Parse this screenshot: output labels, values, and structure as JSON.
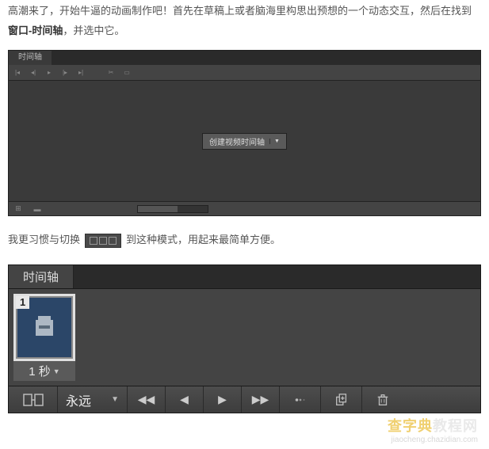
{
  "intro": {
    "part1": "高潮来了，开始牛逼的动画制作吧！首先在草稿上或者脑海里构思出预想的一个动态交互，然后在找到",
    "bold": "窗口-时间轴",
    "part2": "，并选中它。"
  },
  "panel_small": {
    "tab_label": "时间轴",
    "create_button": "创建视频时间轴"
  },
  "mid_text": {
    "part1": "我更习惯与切换",
    "part2": "到这种模式，用起来最简单方便。"
  },
  "panel_large": {
    "tab_label": "时间轴",
    "frame": {
      "number": "1",
      "duration": "1 秒"
    },
    "loop_label": "永远"
  },
  "watermark": {
    "brand_hl": "查字典",
    "brand_rest": "教程网",
    "url": "jiaocheng.chazidian.com"
  }
}
